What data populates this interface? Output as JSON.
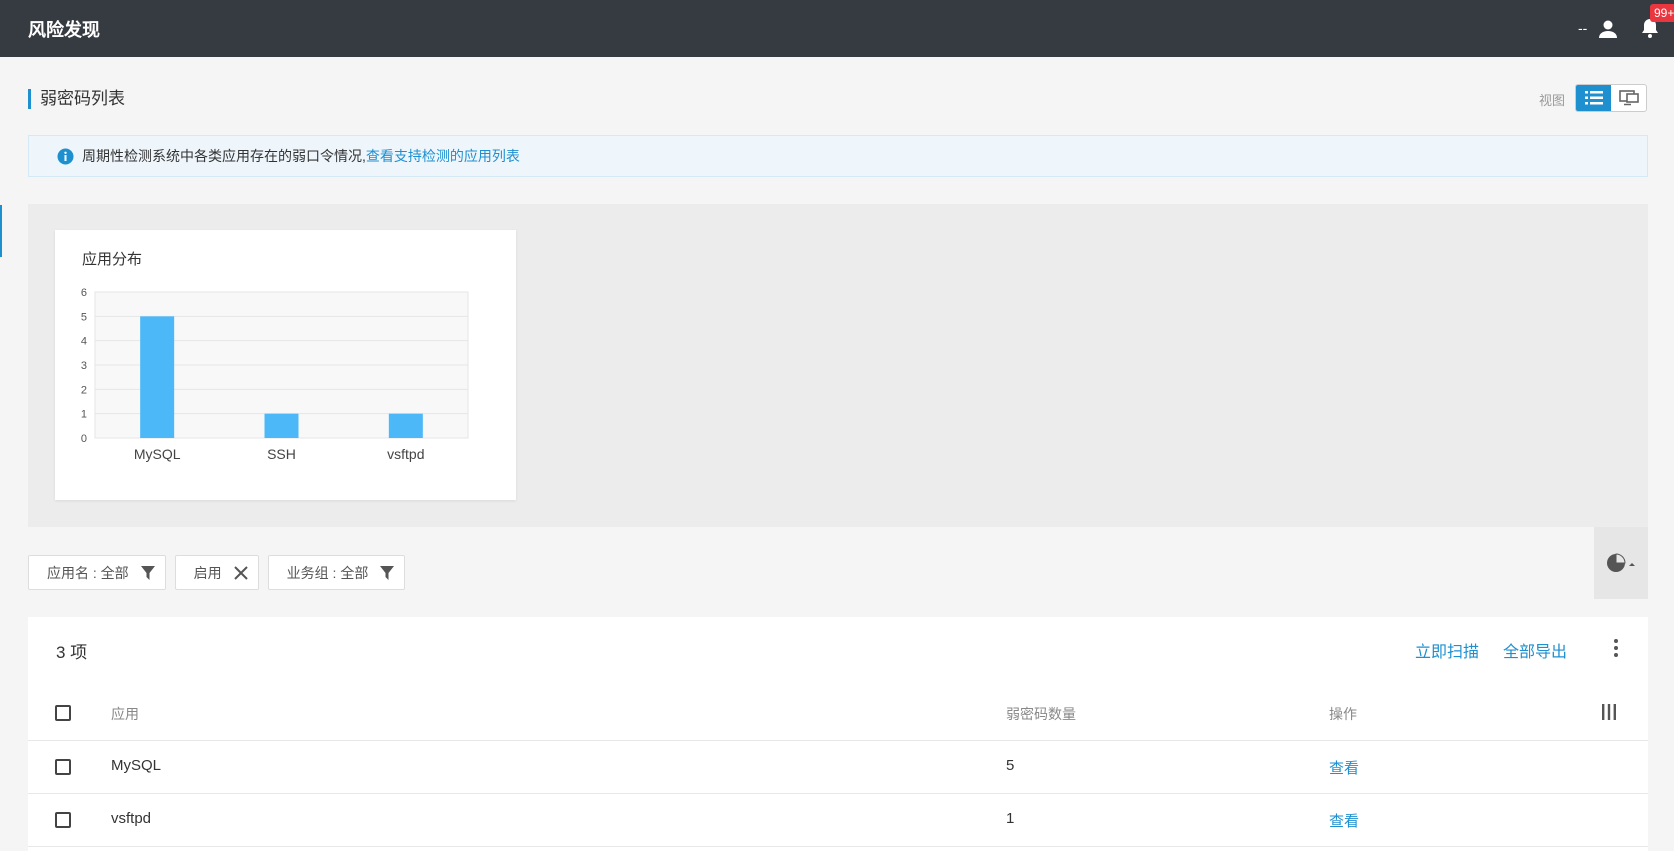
{
  "header": {
    "title": "风险发现",
    "user_name": "--",
    "notification_count": "99+"
  },
  "page": {
    "section_title": "弱密码列表",
    "view_label": "视图"
  },
  "info": {
    "text": "周期性检测系统中各类应用存在的弱口令情况,",
    "link_text": "查看支持检测的应用列表"
  },
  "chart_data": {
    "type": "bar",
    "title": "应用分布",
    "categories": [
      "MySQL",
      "SSH",
      "vsftpd"
    ],
    "values": [
      5,
      1,
      1
    ],
    "yticks": [
      "0",
      "1",
      "2",
      "3",
      "4",
      "5",
      "6"
    ],
    "ylim": [
      0,
      6
    ],
    "grid": true,
    "bar_color": "#4db8f8"
  },
  "filters": [
    {
      "label": "应用名 : 全部",
      "icon": "filter-icon"
    },
    {
      "label": "启用",
      "icon": "close-icon"
    },
    {
      "label": "业务组 : 全部",
      "icon": "filter-icon"
    }
  ],
  "table": {
    "count_label": "3 项",
    "actions": {
      "scan": "立即扫描",
      "export": "全部导出"
    },
    "columns": {
      "app": "应用",
      "weak_count": "弱密码数量",
      "operation": "操作"
    },
    "rows": [
      {
        "app": "MySQL",
        "weak_count": "5",
        "operation": "查看"
      },
      {
        "app": "vsftpd",
        "weak_count": "1",
        "operation": "查看"
      }
    ]
  },
  "colors": {
    "header_bg": "#363b42",
    "accent": "#1e90d0",
    "badge": "#e9363f"
  }
}
